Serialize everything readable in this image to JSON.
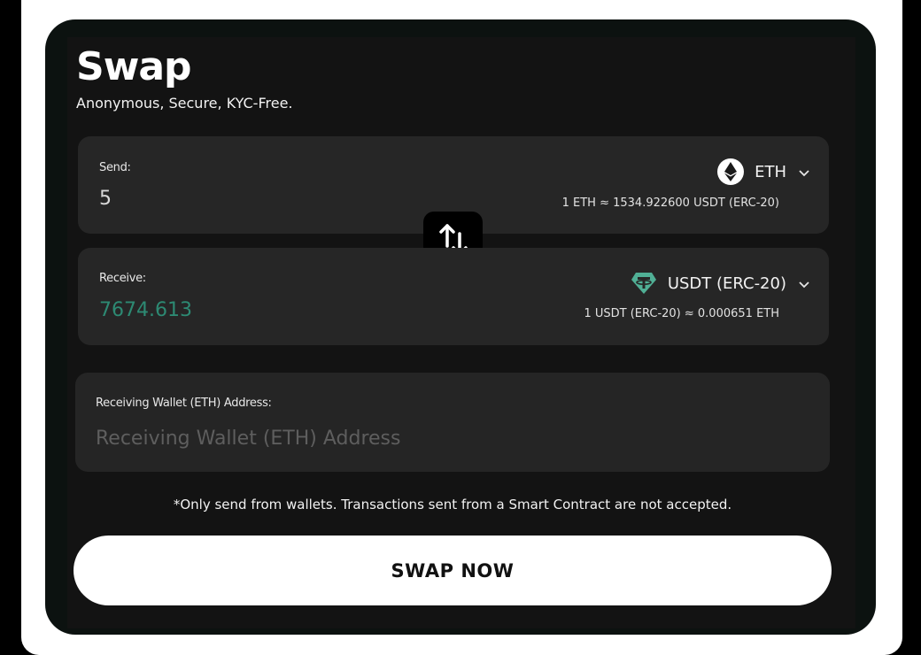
{
  "header": {
    "title": "Swap",
    "subtitle": "Anonymous, Secure, KYC-Free."
  },
  "send": {
    "label": "Send:",
    "amount": "5",
    "token": "ETH",
    "token_icon": "ethereum-icon",
    "rate": "1 ETH ≈ 1534.922600 USDT (ERC-20)"
  },
  "receive": {
    "label": "Receive:",
    "amount": "7674.613",
    "token": "USDT (ERC-20)",
    "token_icon": "tether-icon",
    "rate": "1 USDT (ERC-20) ≈ 0.000651 ETH"
  },
  "swap_toggle": {
    "icon": "swap-arrows-icon"
  },
  "wallet": {
    "label": "Receiving Wallet (ETH) Address:",
    "value": "",
    "placeholder": "Receiving Wallet (ETH) Address"
  },
  "notice": "*Only send from wallets. Transactions sent from a Smart Contract are not accepted.",
  "action": {
    "label": "SWAP NOW"
  },
  "colors": {
    "background": "#131313",
    "card": "#262626",
    "receive_amount": "#2d8a73",
    "tether": "#50af95",
    "button": "#ffffff"
  }
}
